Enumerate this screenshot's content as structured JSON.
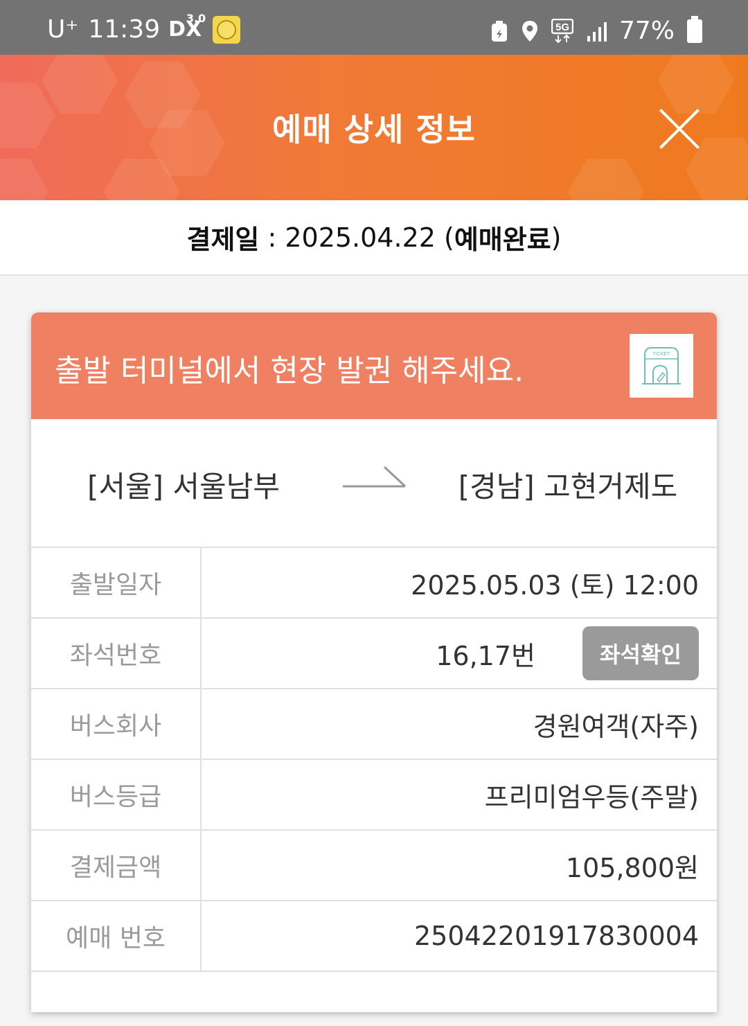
{
  "status_bar": {
    "carrier": "U⁺",
    "time": "11:39",
    "dx_label": "DX",
    "dx_version": "3.0",
    "battery": "77%",
    "icons": [
      "app-icon",
      "cast-icon",
      "location-icon",
      "5g-icon",
      "signal-icon",
      "battery-icon"
    ]
  },
  "header": {
    "title": "예매 상세 정보",
    "close_icon": "close-icon"
  },
  "payment": {
    "label": "결제일",
    "separator": " : ",
    "date": "2025.04.22",
    "status_open": " (",
    "status": "예매완료",
    "status_close": ")"
  },
  "card": {
    "notice": "출발 터미널에서 현장 발권 해주세요.",
    "ticket_icon_text": "TICKET",
    "route": {
      "from": "[서울] 서울남부",
      "to": "[경남] 고현거제도"
    },
    "rows": [
      {
        "label": "출발일자",
        "value": "2025.05.03 (토) 12:00"
      },
      {
        "label": "좌석번호",
        "value": "16,17번",
        "button": "좌석확인"
      },
      {
        "label": "버스회사",
        "value": "경원여객(자주)"
      },
      {
        "label": "버스등급",
        "value": "프리미엄우등(주말)"
      },
      {
        "label": "결제금액",
        "value": "105,800원"
      },
      {
        "label": "예매 번호",
        "value": "25042201917830004"
      }
    ]
  },
  "colors": {
    "header_start": "#f06b5a",
    "header_end": "#ef7a1e",
    "card_head": "#f08062",
    "seat_button": "#9a9a9a"
  }
}
